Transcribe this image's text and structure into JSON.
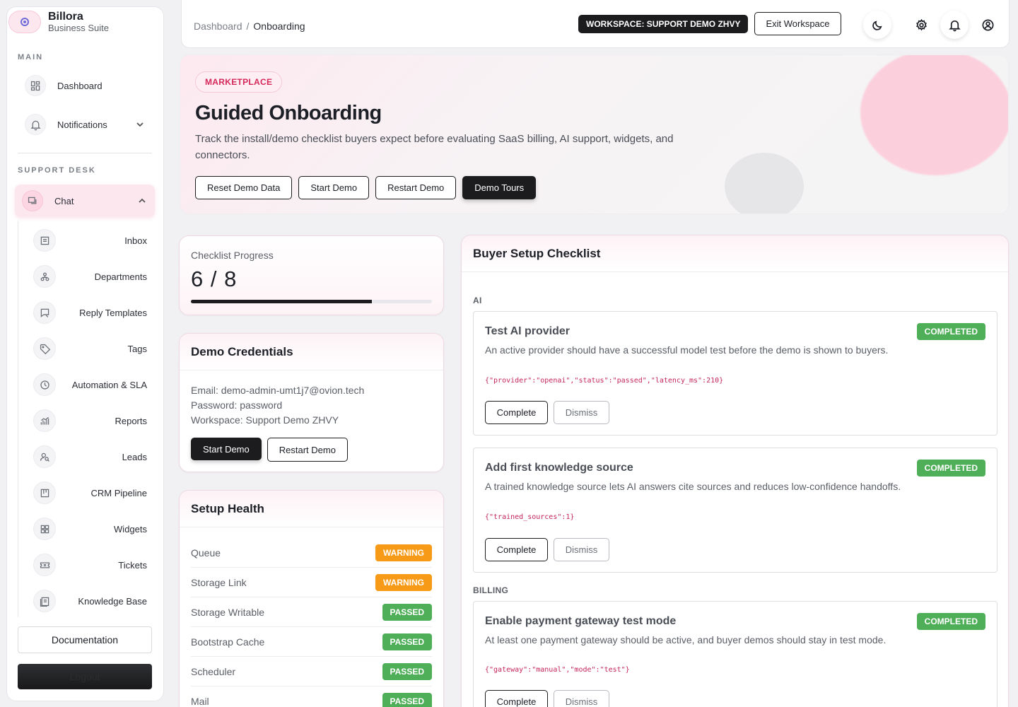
{
  "brand": {
    "name": "Billora",
    "subtitle": "Business Suite"
  },
  "sidebar": {
    "main_label": "MAIN",
    "support_label": "SUPPORT DESK",
    "main_items": [
      {
        "label": "Dashboard",
        "icon": "dashboard-icon"
      },
      {
        "label": "Notifications",
        "icon": "bell-icon"
      }
    ],
    "chat": {
      "label": "Chat",
      "icon": "chat-icon"
    },
    "sub_items": [
      {
        "label": "Inbox",
        "icon": "inbox-icon"
      },
      {
        "label": "Departments",
        "icon": "departments-icon"
      },
      {
        "label": "Reply Templates",
        "icon": "reply-icon"
      },
      {
        "label": "Tags",
        "icon": "tag-icon"
      },
      {
        "label": "Automation & SLA",
        "icon": "clock-icon"
      },
      {
        "label": "Reports",
        "icon": "chart-icon"
      },
      {
        "label": "Leads",
        "icon": "leads-icon"
      },
      {
        "label": "CRM Pipeline",
        "icon": "pipeline-icon"
      },
      {
        "label": "Widgets",
        "icon": "widgets-icon"
      },
      {
        "label": "Tickets",
        "icon": "ticket-icon"
      },
      {
        "label": "Knowledge Base",
        "icon": "book-icon"
      }
    ],
    "documentation": "Documentation",
    "logout": "Logout"
  },
  "topbar": {
    "breadcrumb_root": "Dashboard",
    "breadcrumb_sep": "/",
    "breadcrumb_current": "Onboarding",
    "workspace_badge": "WORKSPACE: SUPPORT DEMO ZHVY",
    "exit_label": "Exit Workspace"
  },
  "hero": {
    "tag": "MARKETPLACE",
    "title": "Guided Onboarding",
    "description": "Track the install/demo checklist buyers expect before evaluating SaaS billing, AI support, widgets, and connectors.",
    "buttons": [
      "Reset Demo Data",
      "Start Demo",
      "Restart Demo",
      "Demo Tours"
    ]
  },
  "progress": {
    "label": "Checklist Progress",
    "value": "6 / 8",
    "completed": 6,
    "total": 8
  },
  "credentials": {
    "title": "Demo Credentials",
    "email": "Email: demo-admin-umt1j7@ovion.tech",
    "password": "Password: password",
    "workspace": "Workspace: Support Demo ZHVY",
    "start": "Start Demo",
    "restart": "Restart Demo"
  },
  "health": {
    "title": "Setup Health",
    "rows": [
      {
        "name": "Queue",
        "status": "WARNING",
        "kind": "warn"
      },
      {
        "name": "Storage Link",
        "status": "WARNING",
        "kind": "warn"
      },
      {
        "name": "Storage Writable",
        "status": "PASSED",
        "kind": "pass"
      },
      {
        "name": "Bootstrap Cache",
        "status": "PASSED",
        "kind": "pass"
      },
      {
        "name": "Scheduler",
        "status": "PASSED",
        "kind": "pass"
      },
      {
        "name": "Mail",
        "status": "PASSED",
        "kind": "pass"
      }
    ]
  },
  "checklist": {
    "title": "Buyer Setup Checklist",
    "groups": [
      "AI",
      "BILLING"
    ],
    "tasks": [
      {
        "title": "Test AI provider",
        "desc": "An active provider should have a successful model test before the demo is shown to buyers.",
        "json": "{\"provider\":\"openai\",\"status\":\"passed\",\"latency_ms\":210}",
        "status": "COMPLETED",
        "complete": "Complete",
        "dismiss": "Dismiss"
      },
      {
        "title": "Add first knowledge source",
        "desc": "A trained knowledge source lets AI answers cite sources and reduces low-confidence handoffs.",
        "json": "{\"trained_sources\":1}",
        "status": "COMPLETED",
        "complete": "Complete",
        "dismiss": "Dismiss"
      },
      {
        "title": "Enable payment gateway test mode",
        "desc": "At least one payment gateway should be active, and buyer demos should stay in test mode.",
        "json": "{\"gateway\":\"manual\",\"mode\":\"test\"}",
        "status": "COMPLETED",
        "complete": "Complete",
        "dismiss": "Dismiss"
      }
    ]
  }
}
